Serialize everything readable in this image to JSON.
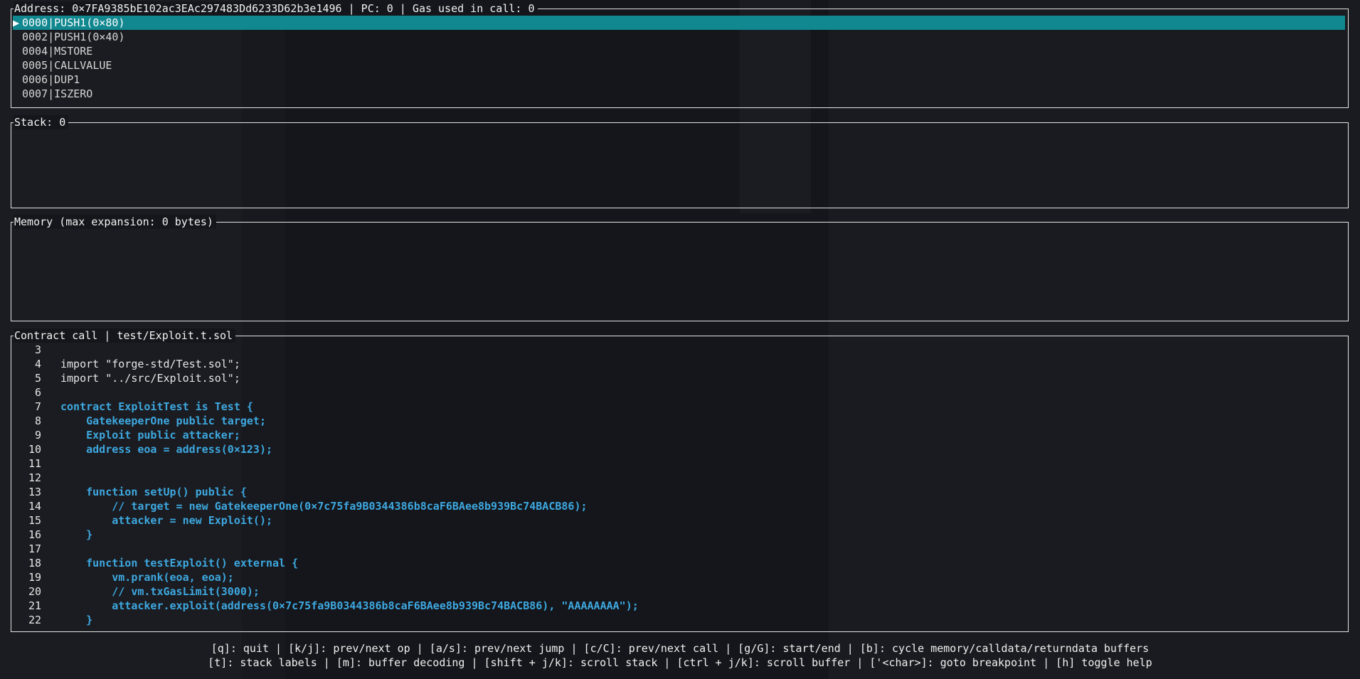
{
  "ops_panel": {
    "title": "Address: 0×7FA9385bE102ac3EAc297483Dd6233D62b3e1496 | PC: 0 | Gas used in call: 0",
    "marker": "▶",
    "rows": [
      {
        "text": "0000|PUSH1(0×80)",
        "active": true
      },
      {
        "text": "0002|PUSH1(0×40)",
        "active": false
      },
      {
        "text": "0004|MSTORE",
        "active": false
      },
      {
        "text": "0005|CALLVALUE",
        "active": false
      },
      {
        "text": "0006|DUP1",
        "active": false
      },
      {
        "text": "0007|ISZERO",
        "active": false
      }
    ]
  },
  "stack_panel": {
    "title": "Stack: 0"
  },
  "memory_panel": {
    "title": "Memory (max expansion: 0 bytes)"
  },
  "source_panel": {
    "title": "Contract call | test/Exploit.t.sol",
    "lines": [
      {
        "n": "3",
        "code": "",
        "hl": false
      },
      {
        "n": "4",
        "code": "import \"forge-std/Test.sol\";",
        "hl": false
      },
      {
        "n": "5",
        "code": "import \"../src/Exploit.sol\";",
        "hl": false
      },
      {
        "n": "6",
        "code": "",
        "hl": false
      },
      {
        "n": "7",
        "code": "contract ExploitTest is Test {",
        "hl": true
      },
      {
        "n": "8",
        "code": "    GatekeeperOne public target;",
        "hl": true
      },
      {
        "n": "9",
        "code": "    Exploit public attacker;",
        "hl": true
      },
      {
        "n": "10",
        "code": "    address eoa = address(0×123);",
        "hl": true
      },
      {
        "n": "11",
        "code": "",
        "hl": false
      },
      {
        "n": "12",
        "code": "",
        "hl": false
      },
      {
        "n": "13",
        "code": "    function setUp() public {",
        "hl": true
      },
      {
        "n": "14",
        "code": "        // target = new GatekeeperOne(0×7c75fa9B0344386b8caF6BAee8b939Bc74BACB86);",
        "hl": true
      },
      {
        "n": "15",
        "code": "        attacker = new Exploit();",
        "hl": true
      },
      {
        "n": "16",
        "code": "    }",
        "hl": true
      },
      {
        "n": "17",
        "code": "",
        "hl": false
      },
      {
        "n": "18",
        "code": "    function testExploit() external {",
        "hl": true
      },
      {
        "n": "19",
        "code": "        vm.prank(eoa, eoa);",
        "hl": true
      },
      {
        "n": "20",
        "code": "        // vm.txGasLimit(3000);",
        "hl": true
      },
      {
        "n": "21",
        "code": "        attacker.exploit(address(0×7c75fa9B0344386b8caF6BAee8b939Bc74BACB86), \"AAAAAAAA\");",
        "hl": true
      },
      {
        "n": "22",
        "code": "    }",
        "hl": true
      }
    ]
  },
  "help": {
    "line1": "[q]: quit | [k/j]: prev/next op | [a/s]: prev/next jump | [c/C]: prev/next call | [g/G]: start/end | [b]: cycle memory/calldata/returndata buffers",
    "line2": "[t]: stack labels | [m]: buffer decoding | [shift + j/k]: scroll stack | [ctrl + j/k]: scroll buffer | ['<char>]: goto breakpoint | [h] toggle help"
  },
  "colors": {
    "background": "#14161b",
    "active_row": "#11878f",
    "source_highlight": "#3ea8e0",
    "border": "#e4e4e4"
  }
}
